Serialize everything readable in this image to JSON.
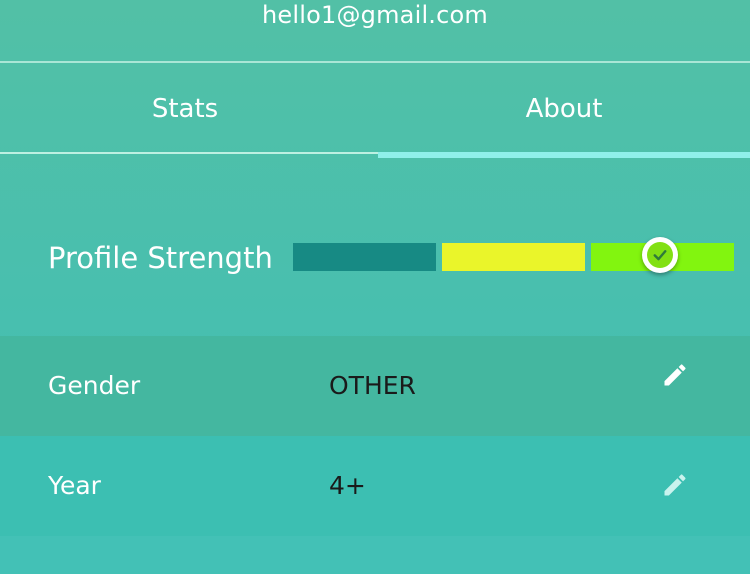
{
  "header": {
    "email": "hello1@gmail.com"
  },
  "tabs": [
    {
      "label": "Stats",
      "active": false
    },
    {
      "label": "About",
      "active": true
    }
  ],
  "profile_strength": {
    "label": "Profile Strength",
    "segments": [
      {
        "color": "#178a84"
      },
      {
        "color": "#eaf52a"
      },
      {
        "color": "#82f50f"
      }
    ],
    "level": 3,
    "max_level": 3,
    "indicator_icon": "check-icon"
  },
  "fields": [
    {
      "label": "Gender",
      "value": "OTHER",
      "action_icon": "pencil-icon"
    },
    {
      "label": "Year",
      "value": "4+",
      "action_icon": "pencil-icon"
    }
  ],
  "colors": {
    "accent": "#8ff0ea",
    "pencil": "#ffffff",
    "pencil_year": "#c9f3ee"
  }
}
